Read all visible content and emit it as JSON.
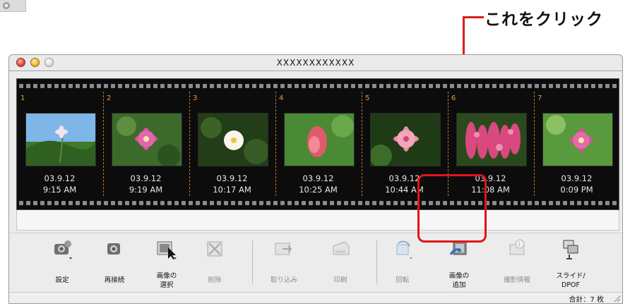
{
  "callout": {
    "text": "これをクリック"
  },
  "window": {
    "title": "XXXXXXXXXXXX"
  },
  "frames": [
    {
      "number": "1",
      "date": "03.9.12",
      "time": "9:15 AM"
    },
    {
      "number": "2",
      "date": "03.9.12",
      "time": "9:19 AM"
    },
    {
      "number": "3",
      "date": "03.9.12",
      "time": "10:17 AM"
    },
    {
      "number": "4",
      "date": "03.9.12",
      "time": "10:25 AM"
    },
    {
      "number": "5",
      "date": "03.9.12",
      "time": "10:44 AM"
    },
    {
      "number": "6",
      "date": "03.9.12",
      "time": "11:08 AM"
    },
    {
      "number": "7",
      "date": "03.9.12",
      "time": "0:09 PM"
    }
  ],
  "toolbar": {
    "settings": "設定",
    "reconnect": "再接続",
    "select_images": "画像の\n選択",
    "delete": "削除",
    "import": "取り込み",
    "print": "印刷",
    "rotate": "回転",
    "add_images": "画像の\n追加",
    "shooting_info": "撮影情報",
    "slide_dpof": "スライド/\nDPOF"
  },
  "status": {
    "total": "合計：7 枚"
  },
  "colors": {
    "highlight": "#e01515",
    "film": "#0c0c0c",
    "frame_number": "#f09a35"
  }
}
